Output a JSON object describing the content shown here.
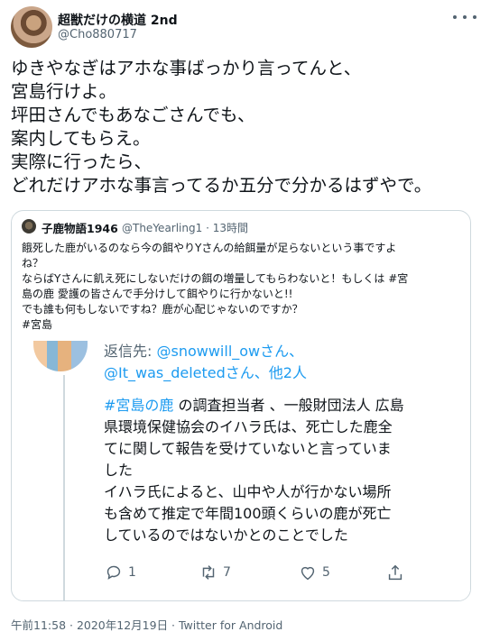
{
  "tweet": {
    "display_name": "超獣だけの横道 2nd",
    "handle": "@Cho880717",
    "text_lines": [
      "ゆきやなぎはアホな事ばっかり言ってんと、",
      "宮島行けよ。",
      "坪田さんでもあなごさんでも、",
      "案内してもらえ。",
      "実際に行ったら、",
      "どれだけアホな事言ってるか五分で分かるはずやで。"
    ],
    "footer": "午前11:58 · 2020年12月19日 · Twitter for Android"
  },
  "quoted": {
    "display_name": "子鹿物語1946",
    "handle_time": "@TheYearling1 · 13時間",
    "text_lines": [
      "餓死した鹿がいるのなら今の餌やりYさんの給餌量が足らないという事ですよ",
      "ね？",
      "ならばYさんに飢え死にしないだけの餌の増量してもらわないと！もしくは #宮",
      "島の鹿 愛護の皆さんで手分けして餌やりに行かないと!!",
      "でも誰も何もしないですね？鹿が心配じゃないのですか？",
      "#宮島"
    ],
    "screenshot": {
      "reply_prefix": "返信先: ",
      "reply_user1": "@snowwill_owさん、",
      "reply_user2": "@It_was_deletedさん、他2人",
      "line1_tag": "#宮島の鹿",
      "line1_rest": " の調査担当者 、一般財団法人 広島",
      "lines": [
        "県環境保健協会のイハラ氏は、死亡した鹿全",
        "てに関して報告を受けていないと言っていま",
        "した",
        "イハラ氏によると、山中や人が行かない場所",
        "も含めて推定で年間100頭くらいの鹿が死亡",
        "しているのではないかとのことでした"
      ],
      "reply_count": "1",
      "retweet_count": "7",
      "like_count": "5"
    }
  },
  "icons": [
    "more-icon",
    "reply-icon",
    "retweet-icon",
    "like-icon",
    "share-icon"
  ],
  "colors": {
    "link": "#1d9bf0",
    "secondary": "#536471",
    "border": "#cfd9de"
  }
}
